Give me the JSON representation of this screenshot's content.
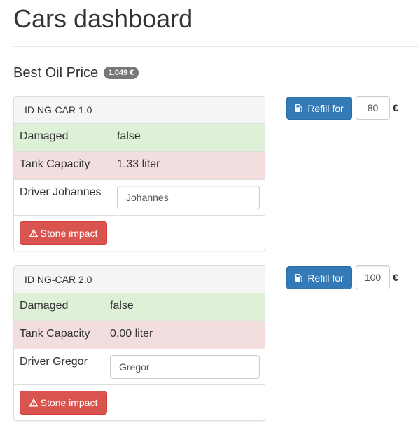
{
  "page": {
    "title": "Cars dashboard",
    "oil_price_label": "Best Oil Price",
    "oil_price_value": "1.049 €"
  },
  "cars": [
    {
      "id_label": "ID NG-CAR 1.0",
      "damaged_label": "Damaged",
      "damaged_value": "false",
      "tank_label": "Tank Capacity",
      "tank_value": "1.33 liter",
      "driver_label": "Driver Johannes",
      "driver_input_value": "Johannes",
      "stone_button_label": "Stone impact",
      "refill_button_label": "Refill for",
      "refill_amount": "80",
      "currency": "€"
    },
    {
      "id_label": "ID NG-CAR 2.0",
      "damaged_label": "Damaged",
      "damaged_value": "false",
      "tank_label": "Tank Capacity",
      "tank_value": "0.00 liter",
      "driver_label": "Driver Gregor",
      "driver_input_value": "Gregor",
      "stone_button_label": "Stone impact",
      "refill_button_label": "Refill for",
      "refill_amount": "100",
      "currency": "€"
    }
  ],
  "colors": {
    "success_row": "#dff0d8",
    "danger_row": "#f2dede",
    "primary_button": "#337ab7",
    "danger_button": "#d9534f",
    "badge": "#777777"
  },
  "icons": {
    "refill": "gas-pump-icon",
    "stone": "warning-icon"
  }
}
